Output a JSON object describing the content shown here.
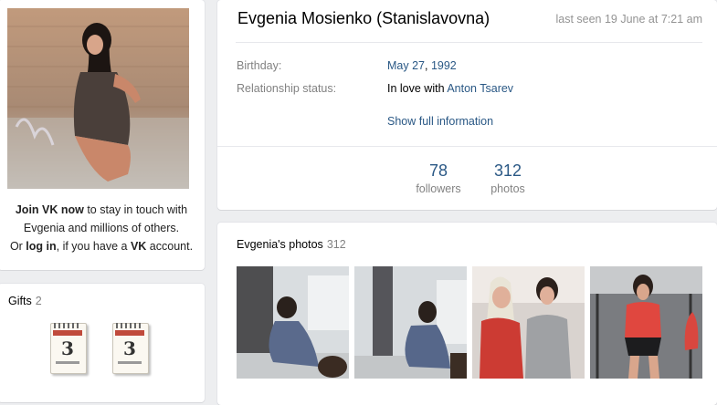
{
  "left": {
    "join": {
      "join_link": "Join VK now",
      "line1_rest": " to stay in touch with",
      "line2": "Evgenia and millions of others.",
      "or": "Or ",
      "login_link": "log in",
      "mid": ", if you have a ",
      "vk": "VK",
      "end": " account."
    },
    "gifts": {
      "title": "Gifts",
      "count": "2",
      "items": [
        {
          "day": "3",
          "icon": "calendar-gift-icon"
        },
        {
          "day": "3",
          "icon": "calendar-gift-icon"
        }
      ]
    }
  },
  "profile": {
    "name": "Evgenia Mosienko (Stanislavovna)",
    "last_seen": "last seen 19 June at 7:21 am",
    "birthday_label": "Birthday:",
    "birthday_date": "May 27",
    "birthday_sep": ", ",
    "birthday_year": "1992",
    "relationship_label": "Relationship status:",
    "relationship_prefix": "In love with ",
    "relationship_partner": "Anton Tsarev",
    "show_full": "Show full information",
    "followers_count": "78",
    "followers_label": "followers",
    "photos_count": "312",
    "photos_label": "photos"
  },
  "photos": {
    "title": "Evgenia's photos",
    "count": "312"
  },
  "colors": {
    "link": "#2a5885",
    "background": "#edeef0",
    "muted": "#828282"
  }
}
